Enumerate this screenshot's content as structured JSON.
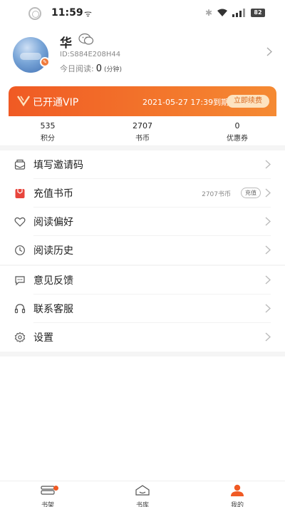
{
  "status_bar": {
    "time": "11:59",
    "battery": "82"
  },
  "profile": {
    "nickname": "华",
    "user_id": "ID:S884E208H44",
    "today_label": "今日阅读:",
    "today_value": "0",
    "today_unit": "(分钟)"
  },
  "vip": {
    "label": "已开通VIP",
    "expire": "2021-05-27 17:39到期",
    "renew": "立即续费"
  },
  "stats": [
    {
      "value": "535",
      "label": "积分"
    },
    {
      "value": "2707",
      "label": "书币"
    },
    {
      "value": "0",
      "label": "优惠券"
    }
  ],
  "menu": {
    "invite": "填写邀请码",
    "recharge": "充值书币",
    "coin_value": "2707书币",
    "recharge_btn": "充值",
    "preference": "阅读偏好",
    "history": "阅读历史",
    "feedback": "意见反馈",
    "service": "联系客服",
    "settings": "设置"
  },
  "nav": [
    {
      "label": "书架"
    },
    {
      "label": "书库"
    },
    {
      "label": "我的"
    }
  ],
  "colors": {
    "accent": "#f05a24",
    "vip_gradient_end": "#f58a33"
  },
  "icons": [
    "wechat-icon",
    "vip-logo-icon",
    "envelope-icon",
    "gift-icon",
    "heart-icon",
    "clock-icon",
    "chat-icon",
    "headset-icon",
    "gear-icon",
    "chevron-right-icon",
    "bookshelf-icon",
    "library-icon",
    "person-icon"
  ]
}
